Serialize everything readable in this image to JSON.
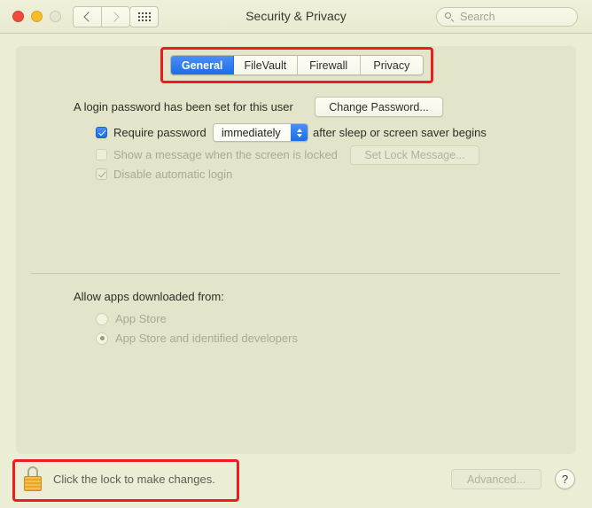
{
  "window": {
    "title": "Security & Privacy",
    "traffic_lights": {
      "close": "close-button",
      "minimize": "minimize-button",
      "zoom": "zoom-button-disabled"
    }
  },
  "toolbar": {
    "back_label": "",
    "forward_label": "",
    "show_all_label": "",
    "search": {
      "placeholder": "Search",
      "value": ""
    }
  },
  "tabs": {
    "items": [
      {
        "label": "General",
        "selected": true
      },
      {
        "label": "FileVault",
        "selected": false
      },
      {
        "label": "Firewall",
        "selected": false
      },
      {
        "label": "Privacy",
        "selected": false
      }
    ]
  },
  "general": {
    "login_password_text": "A login password has been set for this user",
    "change_password_button": "Change Password...",
    "require_password": {
      "label": "Require password",
      "checked": true,
      "popup_value": "immediately",
      "suffix": "after sleep or screen saver begins"
    },
    "show_message": {
      "label": "Show a message when the screen is locked",
      "checked": false,
      "disabled": true,
      "button": "Set Lock Message..."
    },
    "disable_auto_login": {
      "label": "Disable automatic login",
      "checked": true,
      "disabled": true
    },
    "allow_apps_label": "Allow apps downloaded from:",
    "allow_apps_options": [
      {
        "label": "App Store",
        "selected": false
      },
      {
        "label": "App Store and identified developers",
        "selected": true
      }
    ]
  },
  "footer": {
    "lock_text": "Click the lock to make changes.",
    "lock_state": "locked",
    "advanced_button": "Advanced...",
    "advanced_disabled": true,
    "help_button": "?"
  },
  "annotations": {
    "highlight_color": "#ee1c1c",
    "regions": [
      "tab-bar",
      "lock-row"
    ]
  },
  "colors": {
    "accent": "#1a6ee8",
    "window_bg": "#ecedd5",
    "content_bg": "#e4e4cb",
    "lock_gold": "#f6bf4d"
  }
}
